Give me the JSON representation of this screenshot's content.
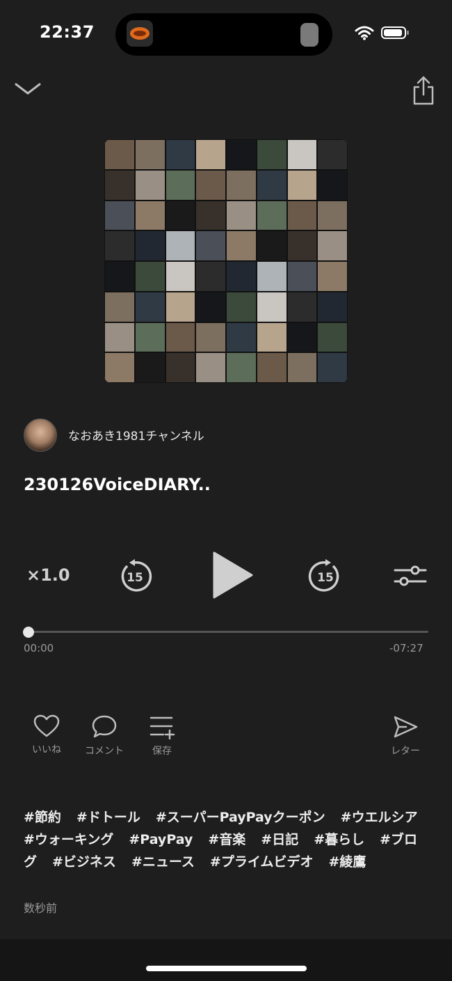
{
  "status": {
    "time": "22:37"
  },
  "channel": {
    "name": "なおあき1981チャンネル"
  },
  "episode": {
    "title": "230126VoiceDIARY.."
  },
  "player": {
    "speed": "×1.0",
    "skip_back_seconds": "15",
    "skip_forward_seconds": "15",
    "progress_fraction": 0.0,
    "elapsed": "00:00",
    "remaining": "-07:27"
  },
  "actions": {
    "like": "いいね",
    "comment": "コメント",
    "save": "保存",
    "letter": "レター"
  },
  "tags": [
    "#節約",
    "#ドトール",
    "#スーパーPayPayクーポン",
    "#ウエルシア",
    "#ウォーキング",
    "#PayPay",
    "#音楽",
    "#日記",
    "#暮らし",
    "#ブログ",
    "#ビジネス",
    "#ニュース",
    "#プライムビデオ",
    "#綾鷹"
  ],
  "posted_ago": "数秒前",
  "colors": {
    "background": "#1e1e1e",
    "text": "#ffffff",
    "muted": "#9a9a9a"
  }
}
